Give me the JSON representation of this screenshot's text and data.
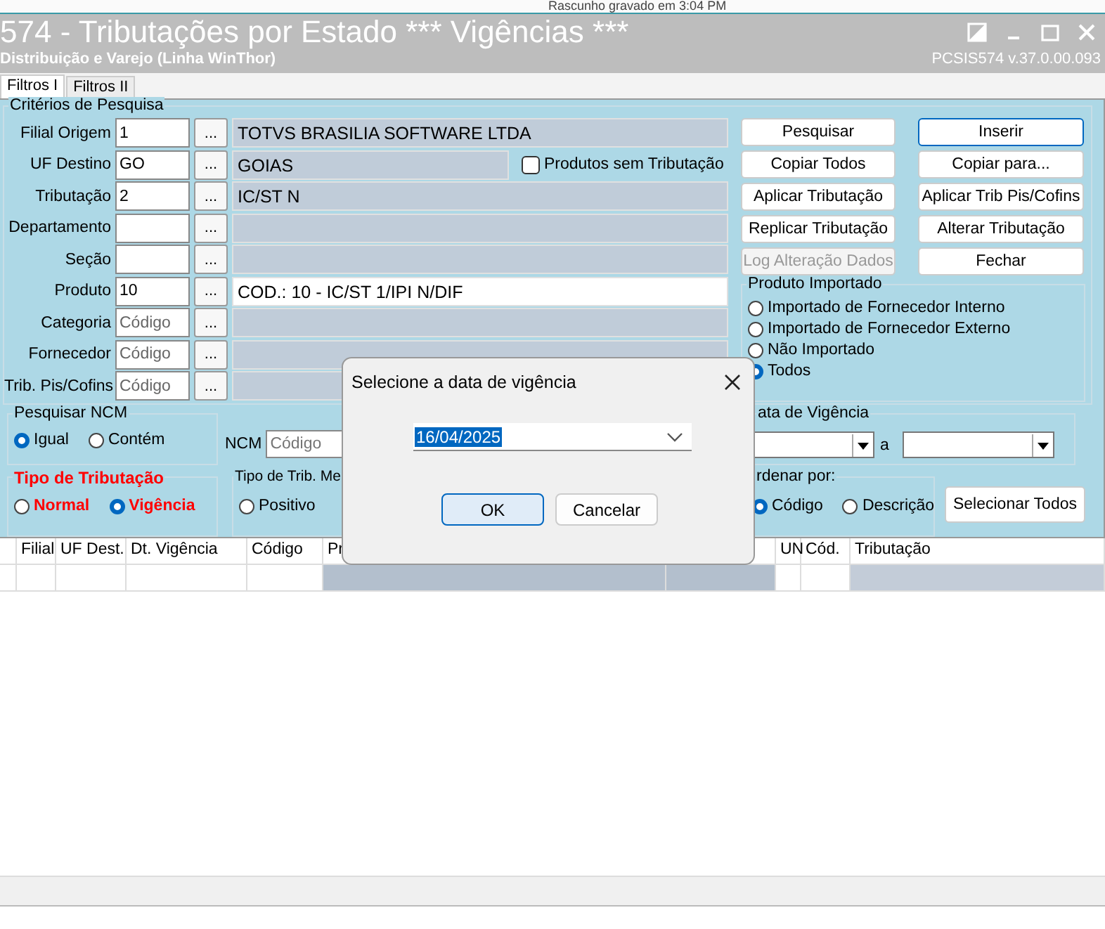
{
  "toolbar": {
    "status": "Rascunho gravado em 3:04 PM"
  },
  "window": {
    "title": "574 - Tributações por Estado *** Vigências ***",
    "subtitle": "Distribuição e Varejo (Linha WinThor)",
    "version": "PCSIS574  v.37.0.00.093"
  },
  "tabs": [
    {
      "label": "Filtros I",
      "selected": true
    },
    {
      "label": "Filtros II",
      "selected": false
    }
  ],
  "criteria": {
    "title": "Critérios de Pesquisa",
    "fields": [
      {
        "label": "Filial Origem",
        "value": "1",
        "description": "TOTVS BRASILIA SOFTWARE LTDA",
        "description_active": false
      },
      {
        "label": "UF Destino",
        "value": "GO",
        "description": "GOIAS",
        "description_active": false
      },
      {
        "label": "Tributação",
        "value": "2",
        "description": "IC/ST N",
        "description_active": false
      },
      {
        "label": "Departamento",
        "description_active": false
      },
      {
        "label": "Seção",
        "description_active": false
      },
      {
        "label": "Produto",
        "value": "10",
        "description": "COD.: 10 - IC/ST 1/IPI N/DIF",
        "description_active": true
      },
      {
        "label": "Categoria",
        "placeholder": "Código",
        "description_active": false
      },
      {
        "label": "Fornecedor",
        "placeholder": "Código",
        "description_active": false
      },
      {
        "label": "Trib. Pis/Cofins",
        "placeholder": "Código",
        "description_active": false
      }
    ],
    "lookup_button": "...",
    "no_tax_checkbox": {
      "label": "Produtos sem Tributação",
      "checked": false
    }
  },
  "buttons": [
    {
      "label": "Pesquisar",
      "disabled": false,
      "default": false
    },
    {
      "label": "Inserir",
      "disabled": false,
      "default": true
    },
    {
      "label": "Copiar Todos",
      "disabled": false,
      "default": false
    },
    {
      "label": "Copiar para...",
      "disabled": false,
      "default": false
    },
    {
      "label": "Aplicar Tributação",
      "disabled": false,
      "default": false
    },
    {
      "label": "Aplicar Trib Pis/Cofins",
      "disabled": false,
      "default": false
    },
    {
      "label": "Replicar Tributação",
      "disabled": false,
      "default": false
    },
    {
      "label": "Alterar Tributação",
      "disabled": false,
      "default": false
    },
    {
      "label": "Log Alteração Dados",
      "disabled": true,
      "default": false
    },
    {
      "label": "Fechar",
      "disabled": false,
      "default": false
    }
  ],
  "imported_product": {
    "title": "Produto Importado",
    "options": [
      {
        "label": "Importado de Fornecedor Interno",
        "selected": false
      },
      {
        "label": "Importado de Fornecedor Externo",
        "selected": false
      },
      {
        "label": "Não Importado",
        "selected": false
      },
      {
        "label": "Todos",
        "selected": true
      }
    ]
  },
  "ncm_search": {
    "title": "Pesquisar NCM",
    "options": [
      {
        "label": "Igual",
        "selected": true
      },
      {
        "label": "Contém",
        "selected": false
      }
    ]
  },
  "ncm": {
    "label": "NCM",
    "placeholder": "Código"
  },
  "validity_date": {
    "title": "ata de Vigência",
    "separator": "a"
  },
  "tax_type": {
    "title": "Tipo de Tributação",
    "options": [
      {
        "label": "Normal",
        "selected": false
      },
      {
        "label": "Vigência",
        "selected": true
      }
    ]
  },
  "trib_me": {
    "title": "Tipo de Trib. Me",
    "options": [
      {
        "label": "Positivo",
        "selected": false
      }
    ]
  },
  "order_by": {
    "title": "rdenar por:",
    "options": [
      {
        "label": "Código",
        "selected": true
      },
      {
        "label": "Descrição",
        "selected": false
      }
    ]
  },
  "select_all_button": "Selecionar Todos",
  "table": {
    "columns": [
      "Filial",
      "UF Dest.",
      "Dt. Vigência",
      "Código",
      "Pr",
      "UN",
      "Cód.",
      "Tributação"
    ]
  },
  "dialog": {
    "title": "Selecione a data de vigência",
    "date_value": "16/04/2025",
    "buttons": [
      {
        "label": "OK",
        "default": true
      },
      {
        "label": "Cancelar",
        "default": false
      }
    ]
  }
}
